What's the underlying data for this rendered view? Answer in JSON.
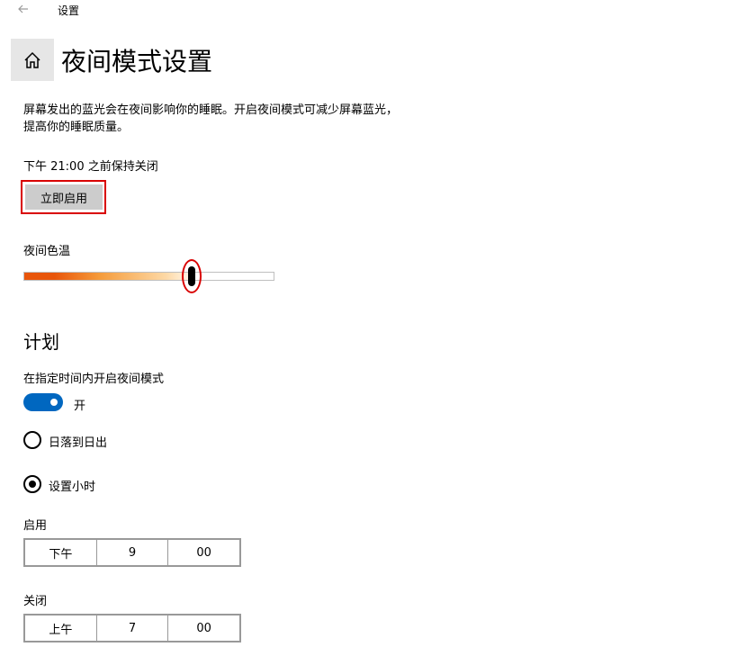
{
  "titlebar": {
    "title": "设置",
    "back_icon": "arrow-left-icon"
  },
  "header": {
    "title": "夜间模式设置",
    "home_icon": "home-icon"
  },
  "description": {
    "line1": "屏幕发出的蓝光会在夜间影响你的睡眠。开启夜间模式可减少屏幕蓝光，",
    "line2": "提高你的睡眠质量。"
  },
  "status": {
    "text": "下午 21:00 之前保持关闭"
  },
  "enable_button": {
    "label": "立即启用"
  },
  "color_temperature": {
    "label": "夜间色温",
    "value_fraction": 0.67,
    "gradient_colors": [
      "#e8550a",
      "#f59b3a",
      "#fdd9a6",
      "#fff6ea"
    ]
  },
  "schedule": {
    "section_title": "计划",
    "toggle_label": "在指定时间内开启夜间模式",
    "toggle_state": "开",
    "toggle_color": "#0067c0",
    "option_sunset": "日落到日出",
    "option_custom": "设置小时",
    "selected": "custom"
  },
  "turn_on": {
    "label": "启用",
    "period": "下午",
    "hour": "9",
    "minute": "00"
  },
  "turn_off": {
    "label": "关闭",
    "period": "上午",
    "hour": "7",
    "minute": "00"
  },
  "accent": {
    "highlight_red": "#d90000"
  }
}
